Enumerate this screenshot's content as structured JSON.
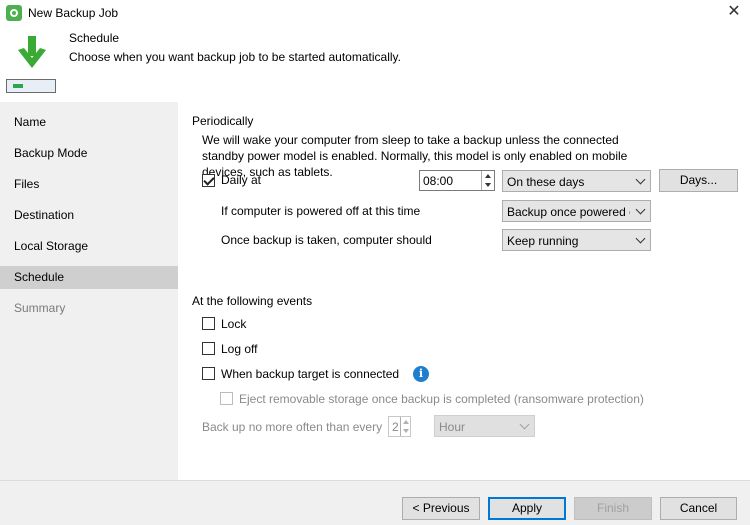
{
  "window": {
    "title": "New Backup Job",
    "close_glyph": "✕"
  },
  "header": {
    "title": "Schedule",
    "subtitle": "Choose when you want backup job to be started automatically."
  },
  "sidebar": {
    "items": [
      {
        "label": "Name"
      },
      {
        "label": "Backup Mode"
      },
      {
        "label": "Files"
      },
      {
        "label": "Destination"
      },
      {
        "label": "Local Storage"
      },
      {
        "label": "Schedule"
      },
      {
        "label": "Summary"
      }
    ]
  },
  "periodically": {
    "label": "Periodically",
    "description": "We will wake your computer from sleep to take a backup unless the connected standby power model is enabled. Normally, this model is only enabled on mobile devices, such as tablets.",
    "daily_label": "Daily at",
    "daily_checked": true,
    "time": "08:00",
    "days_select": "On these days",
    "days_button": "Days...",
    "powered_off_label": "If computer is powered off at this time",
    "powered_off_select": "Backup once powered on",
    "after_backup_label": "Once backup is taken, computer should",
    "after_backup_select": "Keep running"
  },
  "events": {
    "label": "At the following events",
    "lock": "Lock",
    "logoff": "Log off",
    "target_connected": "When backup target is connected",
    "info_glyph": "i",
    "eject": "Eject removable storage once backup is completed (ransomware protection)",
    "no_more_often": "Back up no more often than every",
    "interval_value": "2",
    "interval_unit": "Hour"
  },
  "footer": {
    "previous": "< Previous",
    "apply": "Apply",
    "finish": "Finish",
    "cancel": "Cancel"
  },
  "colors": {
    "accent": "#0078d7",
    "arrow_green": "#3aaa35",
    "sidebar_bg": "#f0f0f0",
    "sidebar_active": "#cfcfcf",
    "info_blue": "#1e7fcf"
  }
}
